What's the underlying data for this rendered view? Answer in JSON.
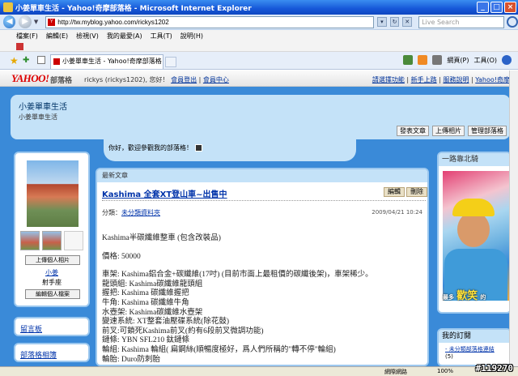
{
  "window": {
    "title": "小姜單車生活 - Yahoo!奇摩部落格 - Microsoft Internet Explorer",
    "controls": [
      "_",
      "□",
      "×"
    ]
  },
  "address": {
    "url": "http://tw.myblog.yahoo.com/rickys1202",
    "search_placeholder": "Live Search"
  },
  "menu": [
    "檔案(F)",
    "編輯(E)",
    "檢視(V)",
    "我的最愛(A)",
    "工具(T)",
    "說明(H)"
  ],
  "tabs": [
    {
      "label": "小姜單車生活 - Yahoo!奇摩部落格"
    }
  ],
  "commandbar": {
    "page": "網頁(P)",
    "tools": "工具(O)"
  },
  "yahoo_bar": {
    "logo": "YAHOO!",
    "logo_sub": "奇摩",
    "product": "部落格",
    "user_text": "rickys (rickys1202), 您好！",
    "logout": "會員登出",
    "member_center": "會員中心",
    "right_links": [
      "請選擇功能",
      "新手上路",
      "服務說明",
      "Yahoo!奇摩"
    ]
  },
  "blog": {
    "title": "小姜單車生活",
    "subtitle": "小姜單車生活",
    "buttons": [
      "發表文章",
      "上傳相片",
      "管理部落格"
    ],
    "greeting": "你好，歡迎參觀我的部落格！"
  },
  "profile": {
    "upload_button": "上傳個人相片",
    "name": "小姜",
    "zodiac": "射手座",
    "edit_button": "編輯個人檔案"
  },
  "left_boxes": [
    "留言板",
    "部落格相簿"
  ],
  "main": {
    "section_title": "最新文章",
    "post_title": "Kashima 全套XT登山車~出售中",
    "edit": "編輯",
    "delete": "刪除",
    "category_label": "分類：",
    "category": "未分類資料夾",
    "date": "2009/04/21 10:24",
    "body": [
      "Kashima半碳纖維整車 (包含改裝品)",
      "",
      "價格: 50000",
      "",
      "車架: Kashima鋁合金+碳纖維(17吋) (目前市面上最租價的碳纖後架)，車架稀少。",
      "龍頭組: Kashima碳纖維龍頭組",
      "握把: Kashima 碳纖維握把",
      "牛角: Kashima 碳纖維牛角",
      "水壺架: Kashima碳纖維水壺架",
      "變速系統: XT整套油壓碟系統(除花鼓)",
      "前叉:可鎖死Kashima前叉(約有6段前叉微調功能)",
      "鏈條: YBN SFL210 鈦鏈條",
      "輪組: Kashima 輪組( 扁鋼絲(順暢度極好，爲人們所稱的\"轉不停\"輪組)",
      "輪胎: Duro防刺胎"
    ]
  },
  "right": {
    "box_title": "一路靠北騎",
    "caption_prefix": "最多",
    "caption_big": "歡笑",
    "caption_suffix": "的",
    "subscription_title": "我的訂閱",
    "subscription_item": "- 未分類部落格連結",
    "subscription_count": "(5)"
  },
  "status": {
    "network": "網際網路",
    "zoom": "100%"
  },
  "watermark": "#119270"
}
